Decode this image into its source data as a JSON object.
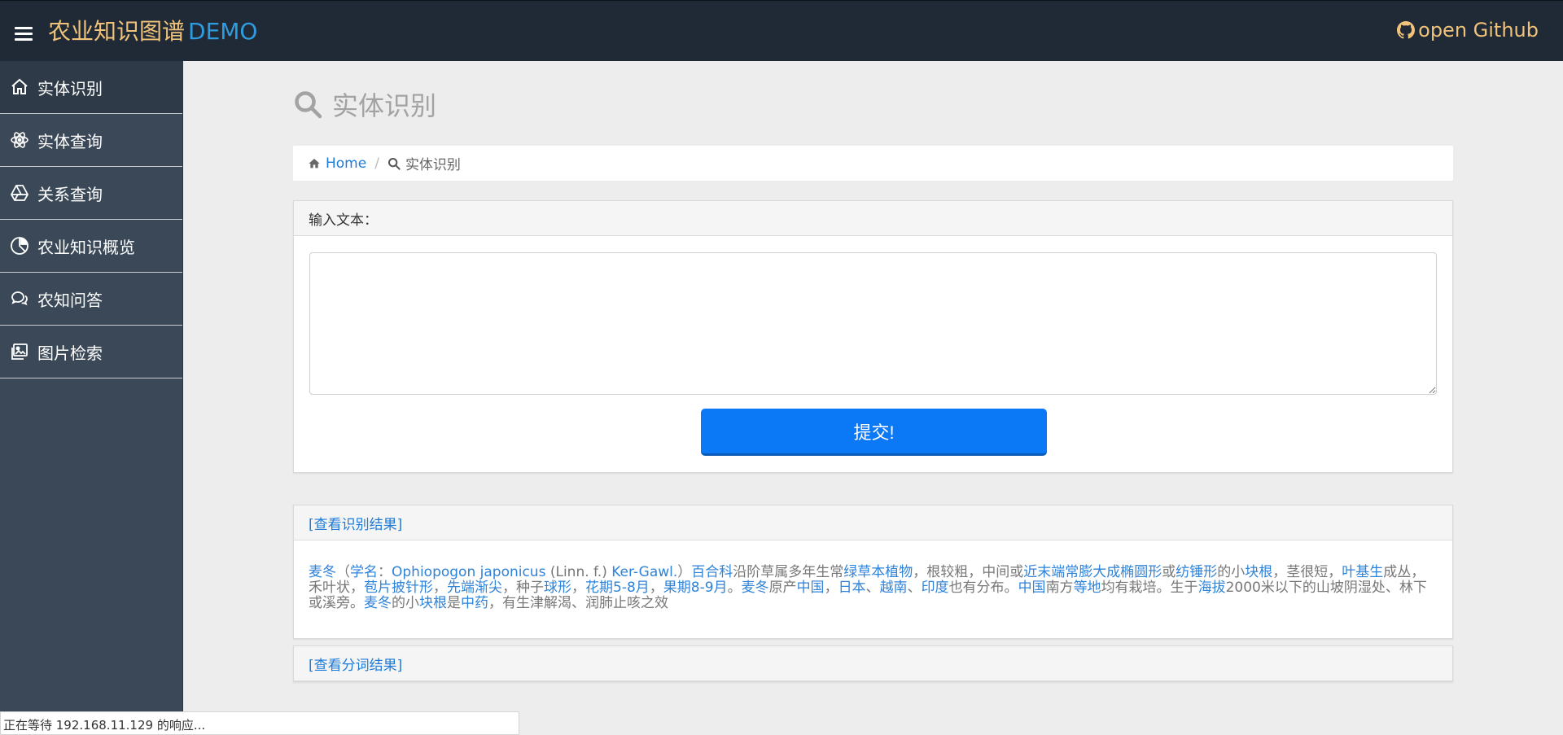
{
  "header": {
    "brand": "农业知识图谱",
    "brand_suffix": "DEMO",
    "github": "open Github"
  },
  "sidebar": {
    "items": [
      {
        "label": "实体识别",
        "icon": "home-icon"
      },
      {
        "label": "实体查询",
        "icon": "atom-icon"
      },
      {
        "label": "关系查询",
        "icon": "drive-icon"
      },
      {
        "label": "农业知识概览",
        "icon": "pie-chart-icon"
      },
      {
        "label": "农知问答",
        "icon": "chat-icon"
      },
      {
        "label": "图片检索",
        "icon": "image-icon"
      }
    ]
  },
  "main": {
    "title": "实体识别",
    "breadcrumb": {
      "home": "Home",
      "current": "实体识别"
    },
    "input_panel": {
      "header": "输入文本：",
      "textarea_value": "",
      "submit": "提交!"
    },
    "result_panel": {
      "header": "[查看识别结果]",
      "segments": [
        {
          "t": "麦冬",
          "e": true
        },
        {
          "t": "（",
          "e": false
        },
        {
          "t": "学名",
          "e": true
        },
        {
          "t": "：",
          "e": false
        },
        {
          "t": "Ophiopogon japonicus",
          "e": true
        },
        {
          "t": " (Linn. f.) ",
          "e": false
        },
        {
          "t": "Ker-Gawl.",
          "e": true
        },
        {
          "t": "）",
          "e": false
        },
        {
          "t": "百合科",
          "e": true
        },
        {
          "t": "沿阶草属多年生常",
          "e": false
        },
        {
          "t": "绿草本植物",
          "e": true
        },
        {
          "t": "，根较粗，中间或",
          "e": false
        },
        {
          "t": "近末端常膨大成椭圆形",
          "e": true
        },
        {
          "t": "或",
          "e": false
        },
        {
          "t": "纺锤形",
          "e": true
        },
        {
          "t": "的小",
          "e": false
        },
        {
          "t": "块根",
          "e": true
        },
        {
          "t": "，茎很短，",
          "e": false
        },
        {
          "t": "叶基生",
          "e": true
        },
        {
          "t": "成丛，禾叶状，",
          "e": false
        },
        {
          "t": "苞片披针形",
          "e": true
        },
        {
          "t": "，",
          "e": false
        },
        {
          "t": "先端渐尖",
          "e": true
        },
        {
          "t": "，种子",
          "e": false
        },
        {
          "t": "球形",
          "e": true
        },
        {
          "t": "，",
          "e": false
        },
        {
          "t": "花期5-8月",
          "e": true
        },
        {
          "t": "，",
          "e": false
        },
        {
          "t": "果期8-9月",
          "e": true
        },
        {
          "t": "。",
          "e": false
        },
        {
          "t": "麦冬",
          "e": true
        },
        {
          "t": "原产",
          "e": false
        },
        {
          "t": "中国",
          "e": true
        },
        {
          "t": "，",
          "e": false
        },
        {
          "t": "日本",
          "e": true
        },
        {
          "t": "、",
          "e": false
        },
        {
          "t": "越南",
          "e": true
        },
        {
          "t": "、",
          "e": false
        },
        {
          "t": "印度",
          "e": true
        },
        {
          "t": "也有分布。",
          "e": false
        },
        {
          "t": "中国",
          "e": true
        },
        {
          "t": "南方",
          "e": false
        },
        {
          "t": "等地",
          "e": true
        },
        {
          "t": "均有栽培。生于",
          "e": false
        },
        {
          "t": "海拔",
          "e": true
        },
        {
          "t": "2000米以下的山坡阴湿处、林下或溪旁。",
          "e": false
        },
        {
          "t": "麦冬",
          "e": true
        },
        {
          "t": "的小",
          "e": false
        },
        {
          "t": "块根",
          "e": true
        },
        {
          "t": "是",
          "e": false
        },
        {
          "t": "中药",
          "e": true
        },
        {
          "t": "，有生津解渴、润肺止咳之效",
          "e": false
        }
      ]
    },
    "seg_panel": {
      "header": "[查看分词结果]"
    }
  },
  "status_bar": "正在等待 192.168.11.129 的响应..."
}
